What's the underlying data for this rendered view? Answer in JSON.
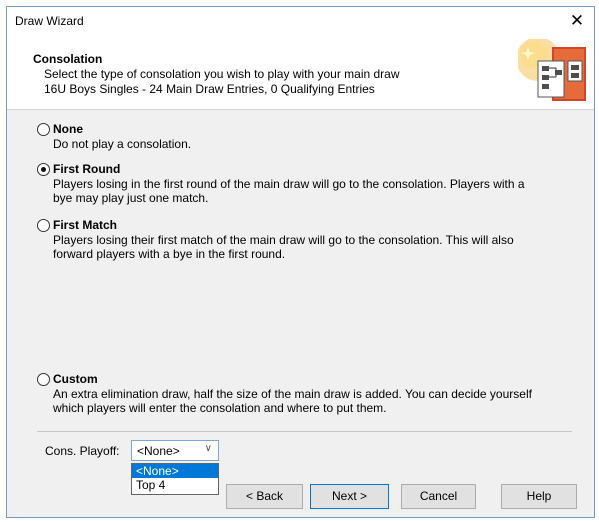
{
  "window": {
    "title": "Draw Wizard",
    "close_glyph": "✕"
  },
  "header": {
    "title": "Consolation",
    "subtitle": "Select the type of consolation you wish to play with your main draw",
    "event_info": "16U Boys Singles - 24 Main Draw Entries, 0 Qualifying Entries",
    "icon": "draw-wizard-icon"
  },
  "options": [
    {
      "label": "None",
      "description": "Do not play a consolation.",
      "checked": false
    },
    {
      "label": "First Round",
      "description": "Players losing in the first round of the main draw will go to the consolation. Players with a bye may play just one match.",
      "checked": true
    },
    {
      "label": "First Match",
      "description": "Players losing their first match of the main draw will go to the consolation. This will also forward players with a bye in the first round.",
      "checked": false
    },
    {
      "label": "Custom",
      "description": "An extra elimination draw, half the size of the main draw is added. You can decide yourself which players will enter the consolation and where to put them.",
      "checked": false
    }
  ],
  "playoff": {
    "label": "Cons. Playoff:",
    "selected": "<None>",
    "options": [
      "<None>",
      "Top 4"
    ]
  },
  "buttons": {
    "back": "< Back",
    "next": "Next >",
    "cancel": "Cancel",
    "help": "Help"
  },
  "colors": {
    "selection": "#0078d7",
    "dialog_bg": "#f0f0f0"
  }
}
